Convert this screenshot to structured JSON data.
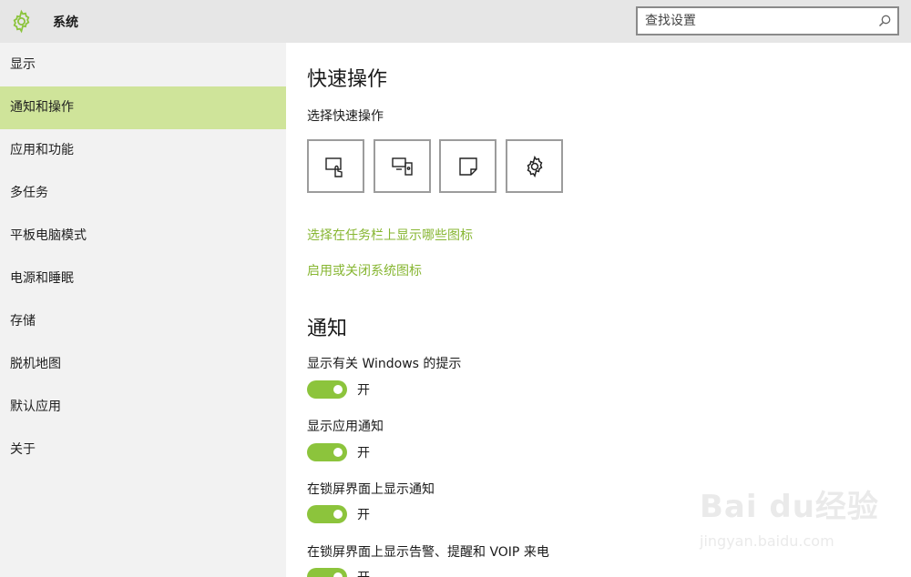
{
  "window": {
    "title": "系统",
    "search": {
      "placeholder": "查找设置"
    }
  },
  "sidebar": {
    "items": [
      {
        "label": "显示"
      },
      {
        "label": "通知和操作",
        "selected": true
      },
      {
        "label": "应用和功能"
      },
      {
        "label": "多任务"
      },
      {
        "label": "平板电脑模式"
      },
      {
        "label": "电源和睡眠"
      },
      {
        "label": "存储"
      },
      {
        "label": "脱机地图"
      },
      {
        "label": "默认应用"
      },
      {
        "label": "关于"
      }
    ]
  },
  "main": {
    "quick_actions": {
      "heading": "快速操作",
      "subheading": "选择快速操作",
      "buttons": [
        {
          "icon": "tablet-mode-icon"
        },
        {
          "icon": "connect-icon"
        },
        {
          "icon": "note-icon"
        },
        {
          "icon": "settings-gear-icon"
        }
      ],
      "links": [
        "选择在任务栏上显示哪些图标",
        "启用或关闭系统图标"
      ]
    },
    "notifications": {
      "heading": "通知",
      "settings": [
        {
          "label": "显示有关 Windows 的提示",
          "state": "开"
        },
        {
          "label": "显示应用通知",
          "state": "开"
        },
        {
          "label": "在锁屏界面上显示通知",
          "state": "开"
        },
        {
          "label": "在锁屏界面上显示告警、提醒和 VOIP 来电",
          "state": "开"
        }
      ]
    }
  },
  "watermark": {
    "brand": "Bai du经验",
    "url": "jingyan.baidu.com"
  },
  "colors": {
    "accent": "#87b632",
    "selected_bg": "#cfe49a",
    "toggle_on": "#8cc43c",
    "sidebar_bg": "#f2f2f2",
    "titlebar_bg": "#e6e6e6"
  }
}
